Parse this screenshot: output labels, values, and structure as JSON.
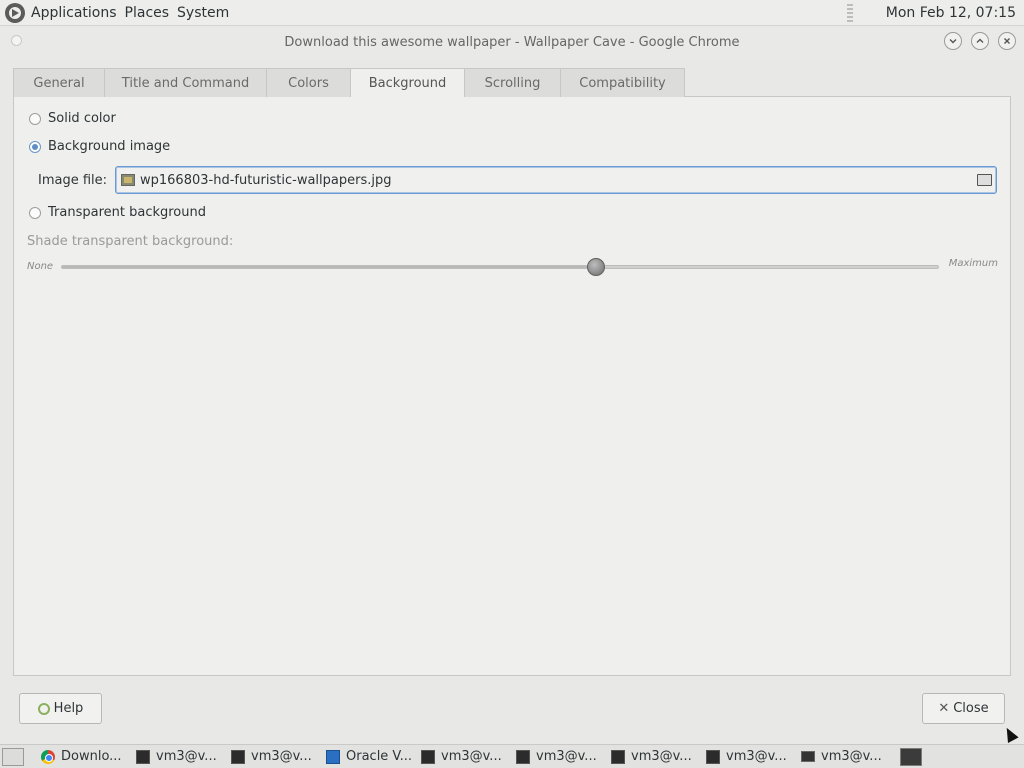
{
  "top_panel": {
    "menus": [
      "Applications",
      "Places",
      "System"
    ],
    "clock": "Mon Feb 12, 07:15"
  },
  "window": {
    "title": "Download this awesome wallpaper - Wallpaper Cave - Google Chrome"
  },
  "tabs": [
    "General",
    "Title and Command",
    "Colors",
    "Background",
    "Scrolling",
    "Compatibility"
  ],
  "active_tab": "Background",
  "background": {
    "solid_color_label": "Solid color",
    "background_image_label": "Background image",
    "transparent_label": "Transparent background",
    "selected_option": "Background image",
    "image_file_label": "Image file:",
    "image_file_value": "wp166803-hd-futuristic-wallpapers.jpg",
    "shade_label": "Shade transparent background:",
    "shade_min_label": "None",
    "shade_max_label": "Maximum",
    "shade_value_fraction": 0.61
  },
  "buttons": {
    "help": "Help",
    "close": "Close"
  },
  "taskbar": {
    "tasks": [
      {
        "label": "Downlo...",
        "icon": "chrome-icon"
      },
      {
        "label": "vm3@v...",
        "icon": "terminal-icon"
      },
      {
        "label": "vm3@v...",
        "icon": "terminal-icon"
      },
      {
        "label": "Oracle V...",
        "icon": "virtualbox-icon"
      },
      {
        "label": "vm3@v...",
        "icon": "terminal-icon"
      },
      {
        "label": "vm3@v...",
        "icon": "terminal-icon"
      },
      {
        "label": "vm3@v...",
        "icon": "terminal-icon"
      },
      {
        "label": "vm3@v...",
        "icon": "terminal-icon"
      },
      {
        "label": "vm3@v...",
        "icon": "monitor-icon"
      }
    ]
  }
}
